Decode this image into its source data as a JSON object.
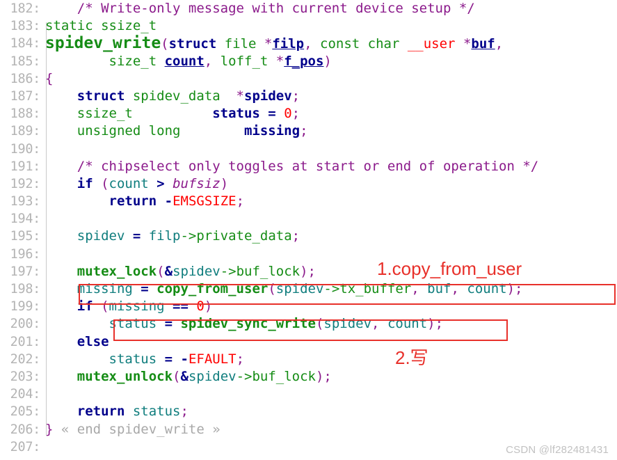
{
  "editor": {
    "language": "C",
    "file_symbol": "spidev_write",
    "first_line_number": 182,
    "last_line_number": 207,
    "gutter_separator": ":"
  },
  "colors": {
    "background": "#ffffff",
    "gutter_text": "#b4b4b4",
    "comment": "#8b1a8b",
    "type": "#158c15",
    "keyword": "#00008b",
    "identifier": "#0f7d7d",
    "function": "#158c15",
    "number": "#ff0000",
    "constant": "#ff0000",
    "punctuation": "#8b1a8b",
    "annotation_red": "#e8302a",
    "fold_marker": "#a8a8a8",
    "watermark": "#c2c2c2"
  },
  "lines": [
    {
      "n": "182",
      "tokens": [
        {
          "t": "comment",
          "s": "    /* Write-only message with current device setup */"
        }
      ]
    },
    {
      "n": "183",
      "tokens": [
        {
          "t": "type",
          "s": "static ssize_t"
        }
      ]
    },
    {
      "n": "184",
      "tokens": [
        {
          "t": "funcdef",
          "s": "spidev_write"
        },
        {
          "t": "punct",
          "s": "("
        },
        {
          "t": "keyword",
          "s": "struct"
        },
        {
          "t": "type",
          "s": " file "
        },
        {
          "t": "punct",
          "s": "*"
        },
        {
          "t": "param",
          "s": "filp"
        },
        {
          "t": "punct",
          "s": ","
        },
        {
          "t": "type",
          "s": " const char "
        },
        {
          "t": "user",
          "s": "__user"
        },
        {
          "t": "type",
          "s": " "
        },
        {
          "t": "punct",
          "s": "*"
        },
        {
          "t": "param",
          "s": "buf"
        },
        {
          "t": "punct",
          "s": ","
        }
      ]
    },
    {
      "n": "185",
      "tokens": [
        {
          "t": "type",
          "s": "        size_t "
        },
        {
          "t": "param",
          "s": "count"
        },
        {
          "t": "punct",
          "s": ","
        },
        {
          "t": "type",
          "s": " loff_t "
        },
        {
          "t": "punct",
          "s": "*"
        },
        {
          "t": "param",
          "s": "f_pos"
        },
        {
          "t": "punct",
          "s": ")"
        }
      ]
    },
    {
      "n": "186",
      "tokens": [
        {
          "t": "brace",
          "s": "{"
        }
      ]
    },
    {
      "n": "187",
      "tokens": [
        {
          "t": "keyword",
          "s": "    struct"
        },
        {
          "t": "type",
          "s": " spidev_data  "
        },
        {
          "t": "punct",
          "s": "*"
        },
        {
          "t": "varname",
          "s": "spidev"
        },
        {
          "t": "punct",
          "s": ";"
        }
      ]
    },
    {
      "n": "188",
      "tokens": [
        {
          "t": "type",
          "s": "    ssize_t          "
        },
        {
          "t": "varname",
          "s": "status"
        },
        {
          "t": "op",
          "s": " = "
        },
        {
          "t": "number",
          "s": "0"
        },
        {
          "t": "punct",
          "s": ";"
        }
      ]
    },
    {
      "n": "189",
      "tokens": [
        {
          "t": "type",
          "s": "    unsigned long        "
        },
        {
          "t": "varname",
          "s": "missing"
        },
        {
          "t": "punct",
          "s": ";"
        }
      ]
    },
    {
      "n": "190",
      "tokens": []
    },
    {
      "n": "191",
      "tokens": [
        {
          "t": "comment",
          "s": "    /* chipselect only toggles at start or end of operation */"
        }
      ]
    },
    {
      "n": "192",
      "tokens": [
        {
          "t": "keyword",
          "s": "    if"
        },
        {
          "t": "punct",
          "s": " ("
        },
        {
          "t": "ident",
          "s": "count"
        },
        {
          "t": "op",
          "s": " > "
        },
        {
          "t": "italicvar",
          "s": "bufsiz"
        },
        {
          "t": "punct",
          "s": ")"
        }
      ]
    },
    {
      "n": "193",
      "tokens": [
        {
          "t": "keyword",
          "s": "        return"
        },
        {
          "t": "plain",
          "s": " "
        },
        {
          "t": "op",
          "s": "-"
        },
        {
          "t": "const",
          "s": "EMSGSIZE"
        },
        {
          "t": "punct",
          "s": ";"
        }
      ]
    },
    {
      "n": "194",
      "tokens": []
    },
    {
      "n": "195",
      "tokens": [
        {
          "t": "ident",
          "s": "    spidev"
        },
        {
          "t": "op",
          "s": " = "
        },
        {
          "t": "ident",
          "s": "filp"
        },
        {
          "t": "member",
          "s": "->private_data"
        },
        {
          "t": "punct",
          "s": ";"
        }
      ]
    },
    {
      "n": "196",
      "tokens": []
    },
    {
      "n": "197",
      "tokens": [
        {
          "t": "func",
          "s": "    mutex_lock"
        },
        {
          "t": "punct",
          "s": "("
        },
        {
          "t": "op",
          "s": "&"
        },
        {
          "t": "ident",
          "s": "spidev"
        },
        {
          "t": "member",
          "s": "->buf_lock"
        },
        {
          "t": "punct",
          "s": ");"
        }
      ]
    },
    {
      "n": "198",
      "tokens": [
        {
          "t": "ident",
          "s": "    missing"
        },
        {
          "t": "op",
          "s": " = "
        },
        {
          "t": "func",
          "s": "copy_from_user"
        },
        {
          "t": "punct",
          "s": "("
        },
        {
          "t": "ident",
          "s": "spidev"
        },
        {
          "t": "member",
          "s": "->tx_buffer"
        },
        {
          "t": "punct",
          "s": ","
        },
        {
          "t": "ident",
          "s": " buf"
        },
        {
          "t": "punct",
          "s": ","
        },
        {
          "t": "ident",
          "s": " count"
        },
        {
          "t": "punct",
          "s": ");"
        }
      ]
    },
    {
      "n": "199",
      "tokens": [
        {
          "t": "keyword",
          "s": "    if"
        },
        {
          "t": "punct",
          "s": " ("
        },
        {
          "t": "ident",
          "s": "missing"
        },
        {
          "t": "op",
          "s": " == "
        },
        {
          "t": "number",
          "s": "0"
        },
        {
          "t": "punct",
          "s": ")"
        }
      ]
    },
    {
      "n": "200",
      "tokens": [
        {
          "t": "ident",
          "s": "        status"
        },
        {
          "t": "op",
          "s": " = "
        },
        {
          "t": "func",
          "s": "spidev_sync_write"
        },
        {
          "t": "punct",
          "s": "("
        },
        {
          "t": "ident",
          "s": "spidev"
        },
        {
          "t": "punct",
          "s": ","
        },
        {
          "t": "ident",
          "s": " count"
        },
        {
          "t": "punct",
          "s": ");"
        }
      ]
    },
    {
      "n": "201",
      "tokens": [
        {
          "t": "keyword",
          "s": "    else"
        }
      ]
    },
    {
      "n": "202",
      "tokens": [
        {
          "t": "ident",
          "s": "        status"
        },
        {
          "t": "op",
          "s": " = "
        },
        {
          "t": "op",
          "s": "-"
        },
        {
          "t": "const",
          "s": "EFAULT"
        },
        {
          "t": "punct",
          "s": ";"
        }
      ]
    },
    {
      "n": "203",
      "tokens": [
        {
          "t": "func",
          "s": "    mutex_unlock"
        },
        {
          "t": "punct",
          "s": "("
        },
        {
          "t": "op",
          "s": "&"
        },
        {
          "t": "ident",
          "s": "spidev"
        },
        {
          "t": "member",
          "s": "->buf_lock"
        },
        {
          "t": "punct",
          "s": ");"
        }
      ]
    },
    {
      "n": "204",
      "tokens": []
    },
    {
      "n": "205",
      "tokens": [
        {
          "t": "keyword",
          "s": "    return"
        },
        {
          "t": "ident",
          "s": " status"
        },
        {
          "t": "punct",
          "s": ";"
        }
      ]
    },
    {
      "n": "206",
      "tokens": [
        {
          "t": "brace",
          "s": "}"
        },
        {
          "t": "fold",
          "s": " « end spidev_write »"
        }
      ]
    },
    {
      "n": "207",
      "tokens": []
    }
  ],
  "annotations": {
    "label_1": "1.copy_from_user",
    "label_2": "2.写",
    "box_1_target_line": "198",
    "box_2_target_line": "200"
  },
  "watermark": {
    "text": "CSDN @lf282481431"
  }
}
